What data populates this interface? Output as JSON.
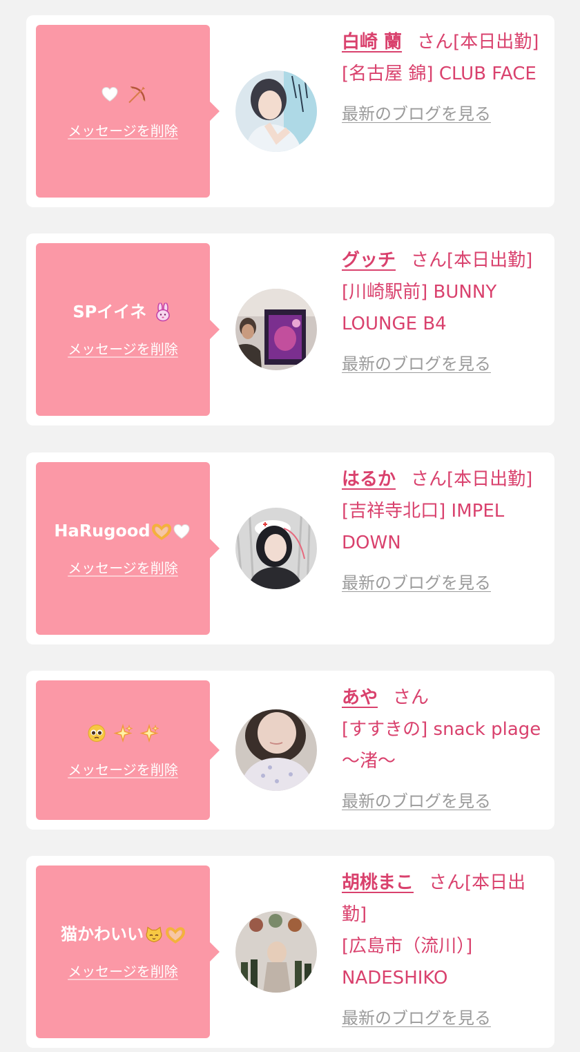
{
  "cards": [
    {
      "message": "",
      "message_emojis": [
        "white-heart",
        "bow-and-arrow"
      ],
      "delete_label": "メッセージを削除",
      "name": "白崎 蘭",
      "honorific": "さん[本日出勤]",
      "shop": "[名古屋 錦] CLUB FACE",
      "blog_label": "最新のブログを見る",
      "avatar": "avatar-photo"
    },
    {
      "message": "SPイイネ",
      "message_emojis": [
        "rabbit-face"
      ],
      "delete_label": "メッセージを削除",
      "name": "グッチ",
      "honorific": "さん[本日出勤]",
      "shop": "[川崎駅前] BUNNY LOUNGE B4",
      "blog_label": "最新のブログを見る",
      "avatar": "avatar-photo"
    },
    {
      "message": "HaRugood",
      "message_emojis": [
        "heart-hands",
        "white-heart"
      ],
      "delete_label": "メッセージを削除",
      "name": "はるか",
      "honorific": "さん[本日出勤]",
      "shop": "[吉祥寺北口] IMPEL DOWN",
      "blog_label": "最新のブログを見る",
      "avatar": "avatar-photo"
    },
    {
      "message": "",
      "message_emojis": [
        "pleading-face",
        "sparkles",
        "sparkles"
      ],
      "delete_label": "メッセージを削除",
      "name": "あや",
      "honorific": "さん",
      "shop": "[すすきの] snack plage ～渚～",
      "blog_label": "最新のブログを見る",
      "avatar": "avatar-photo"
    },
    {
      "message": "猫かわいい",
      "message_emojis": [
        "cat-face",
        "heart-hands"
      ],
      "delete_label": "メッセージを削除",
      "name": "胡桃まこ",
      "honorific": "さん[本日出勤]",
      "shop": "[広島市（流川）] NADESHIKO",
      "blog_label": "最新のブログを見る",
      "avatar": "avatar-photo"
    }
  ],
  "colors": {
    "page_bg": "#f2f2f2",
    "card_bg": "#ffffff",
    "bubble_bg": "#fb98a6",
    "accent_text": "#d9416d",
    "link_gray": "#9b9b9b"
  }
}
